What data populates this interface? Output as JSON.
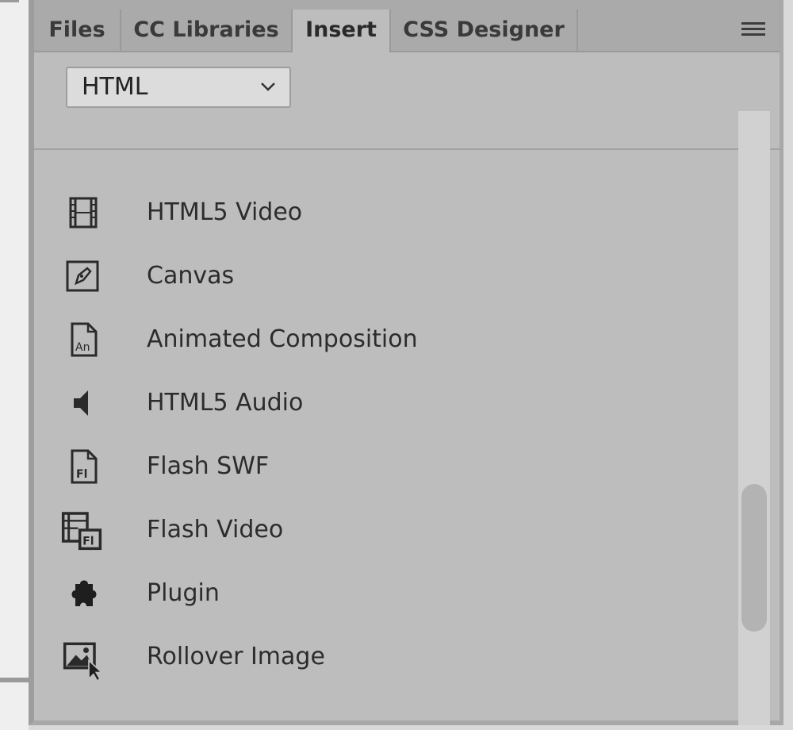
{
  "tabs": [
    {
      "label": "Files"
    },
    {
      "label": "CC Libraries"
    },
    {
      "label": "Insert"
    },
    {
      "label": "CSS Designer"
    }
  ],
  "category_select": {
    "value": "HTML"
  },
  "items": [
    {
      "label": "HTML5 Video",
      "icon": "film-icon"
    },
    {
      "label": "Canvas",
      "icon": "canvas-icon"
    },
    {
      "label": "Animated Composition",
      "icon": "animate-file-icon"
    },
    {
      "label": "HTML5 Audio",
      "icon": "speaker-icon"
    },
    {
      "label": "Flash SWF",
      "icon": "flash-file-icon"
    },
    {
      "label": "Flash Video",
      "icon": "flash-video-icon"
    },
    {
      "label": "Plugin",
      "icon": "puzzle-icon"
    },
    {
      "label": "Rollover Image",
      "icon": "rollover-image-icon"
    }
  ],
  "colors": {
    "panel": "#bdbdbd",
    "tabbar": "#aaaaaa",
    "text": "#2c2c2c"
  }
}
